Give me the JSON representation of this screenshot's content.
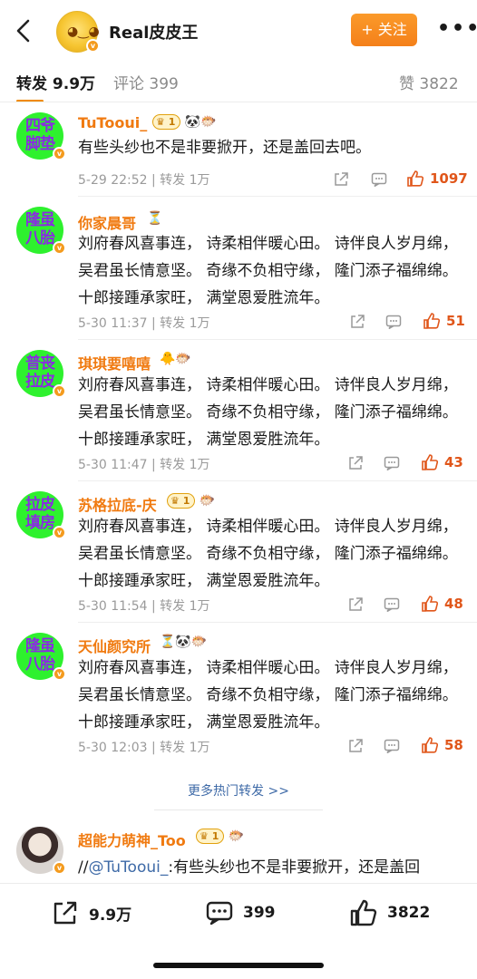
{
  "header": {
    "title": "Real皮皮王",
    "follow_label": "+ 关注",
    "more_label": "•••",
    "back_icon": "chevron-left-icon"
  },
  "tabs": {
    "repost": "转发 9.9万",
    "comment": "评论 399",
    "like": "赞 3822"
  },
  "items": [
    {
      "avatar_text": "四爷脚垫",
      "name": "TuTooui_",
      "badge_level": "1",
      "emoji": "🐼🐡",
      "content": "有些头纱也不是非要掀开，还是盖回去吧。",
      "meta": "5-29 22:52 | 转发 1万",
      "likes": "1097"
    },
    {
      "avatar_text": "隆虽八胎",
      "name": "你家晨哥",
      "emoji": "⏳",
      "content": "刘府春风喜事连， 诗柔相伴暖心田。 诗伴良人岁月绵， 吴君虽长情意坚。 奇缘不负相守缘， 隆门添子福绵绵。 十郎接踵承家旺， 满堂恩爱胜流年。",
      "meta": "5-30 11:37 | 转发 1万",
      "likes": "51"
    },
    {
      "avatar_text": "普丧拉皮",
      "name": "琪琪要嘻嘻",
      "emoji": "🐥🐡",
      "content": "刘府春风喜事连， 诗柔相伴暖心田。 诗伴良人岁月绵， 吴君虽长情意坚。 奇缘不负相守缘， 隆门添子福绵绵。 十郎接踵承家旺， 满堂恩爱胜流年。",
      "meta": "5-30 11:47 | 转发 1万",
      "likes": "43"
    },
    {
      "avatar_text": "拉皮填房",
      "name": "苏格拉底-庆",
      "badge_level": "1",
      "emoji": "🐡",
      "content": "刘府春风喜事连， 诗柔相伴暖心田。 诗伴良人岁月绵， 吴君虽长情意坚。 奇缘不负相守缘， 隆门添子福绵绵。 十郎接踵承家旺， 满堂恩爱胜流年。",
      "meta": "5-30 11:54 | 转发 1万",
      "likes": "48"
    },
    {
      "avatar_text": "隆虽八胎",
      "name": "天仙颜究所",
      "emoji": "⏳🐼🐡",
      "content": "刘府春风喜事连， 诗柔相伴暖心田。 诗伴良人岁月绵， 吴君虽长情意坚。 奇缘不负相守缘， 隆门添子福绵绵。 十郎接踵承家旺， 满堂恩爱胜流年。",
      "meta": "5-30 12:03 | 转发 1万",
      "likes": "58"
    }
  ],
  "more_hot": "更多热门转发 >>",
  "partial_item": {
    "name": "超能力萌神_Too",
    "badge_level": "1",
    "emoji": "🐡",
    "prefix": "//",
    "mention": "@TuTooui_",
    "text": ":有些头纱也不是非要掀开，还是盖回"
  },
  "bottom_bar": {
    "repost_count": "9.9万",
    "comment_count": "399",
    "like_count": "3822"
  },
  "colors": {
    "accent_orange": "#f4801a",
    "username": "#f07a10",
    "like_red": "#e0561a",
    "link_blue": "#3e6aa7",
    "avatar_green": "#2ef12e",
    "avatar_text_purple": "#8a2be2"
  }
}
